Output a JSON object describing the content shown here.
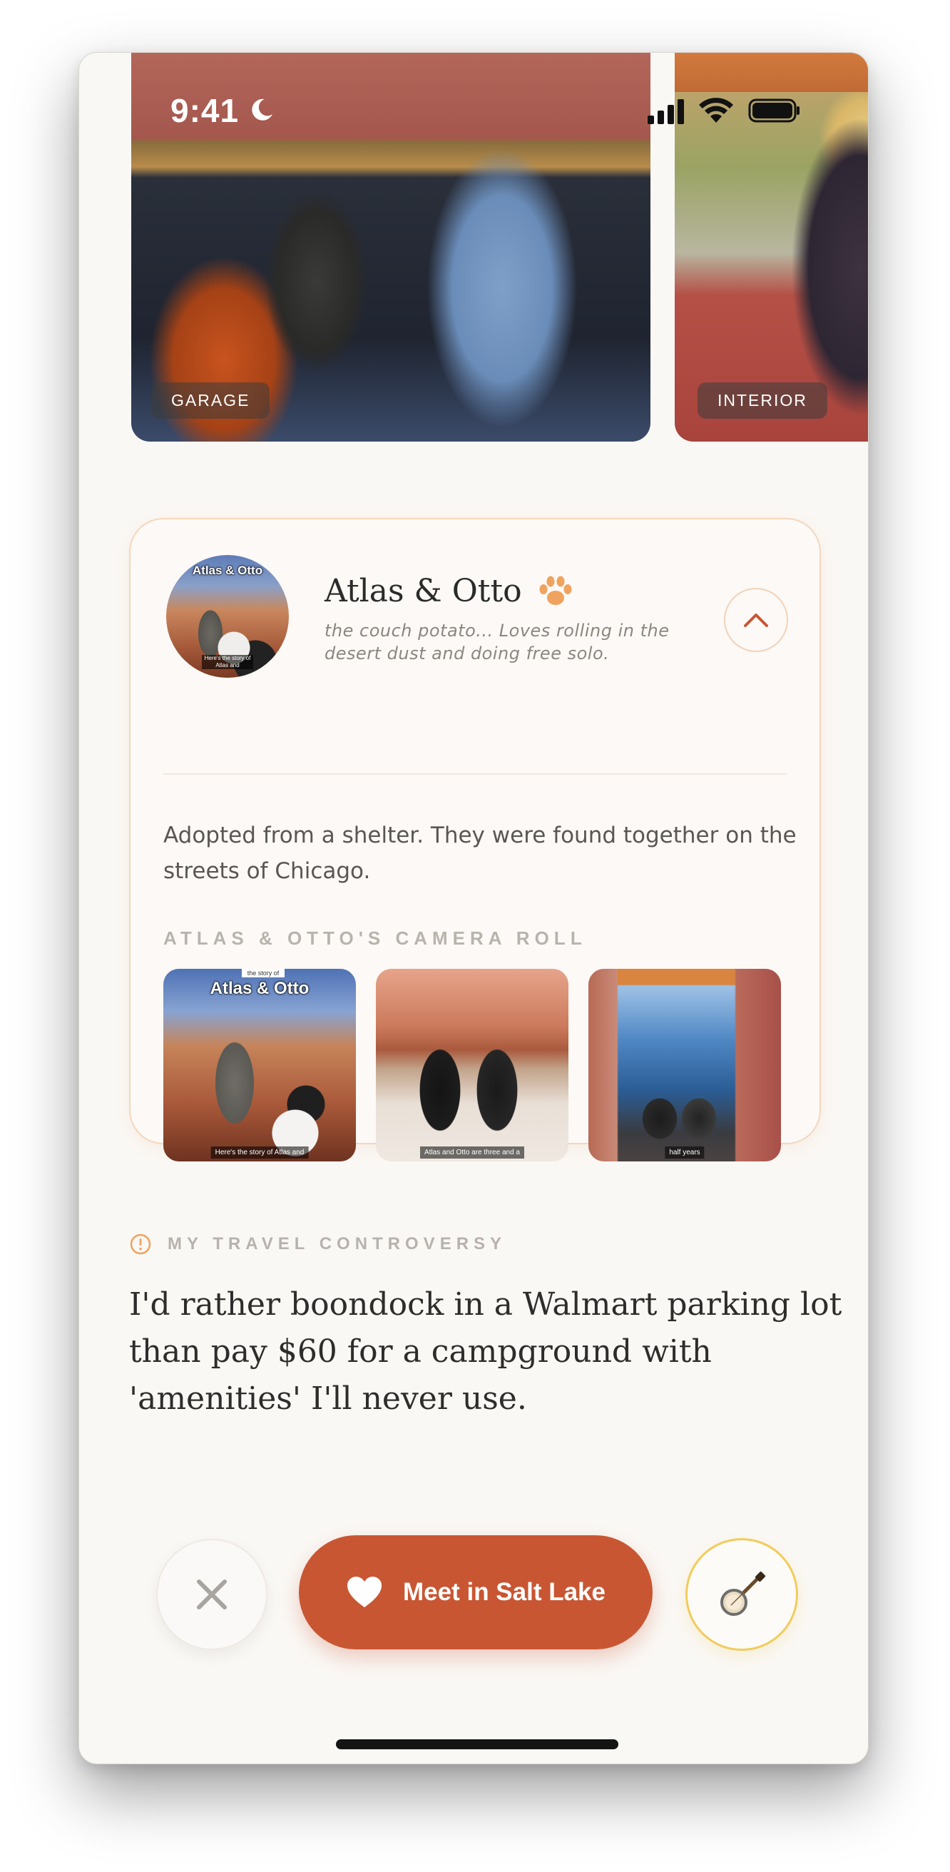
{
  "status_bar": {
    "time": "9:41"
  },
  "photos": [
    {
      "label": "GARAGE"
    },
    {
      "label": "INTERIOR"
    }
  ],
  "pet": {
    "name": "Atlas & Otto",
    "tagline": "the couch potato... Loves rolling in the desert dust and doing free solo.",
    "story": "Adopted from a shelter. They were found together on the streets of Chicago.",
    "avatar_title": "Atlas & Otto",
    "avatar_caption": "Here's the story of Atlas and",
    "camera_roll_heading": "ATLAS & OTTO'S CAMERA ROLL",
    "camera_roll": [
      {
        "kicker": "the story of",
        "title": "Atlas & Otto",
        "caption": "Here's the story of Atlas and"
      },
      {
        "caption": "Atlas and Otto are three and a"
      },
      {
        "caption": "half years"
      }
    ]
  },
  "controversy": {
    "heading": "MY TRAVEL CONTROVERSY",
    "text": "I'd rather boondock in a Walmart parking lot than pay $60 for a campground with 'amenities' I'll never use."
  },
  "actions": {
    "meet_label": "Meet in Salt Lake"
  },
  "colors": {
    "accent": "#c85633",
    "paw": "#f0a35e",
    "background": "#faf8f5",
    "card_border": "#f4d7bd",
    "banjo_ring": "#f1cc5d"
  },
  "icons": [
    "moon-icon",
    "signal-icon",
    "wifi-icon",
    "battery-icon",
    "paw-icon",
    "chevron-up-icon",
    "alert-icon",
    "close-icon",
    "heart-icon",
    "banjo-icon"
  ]
}
